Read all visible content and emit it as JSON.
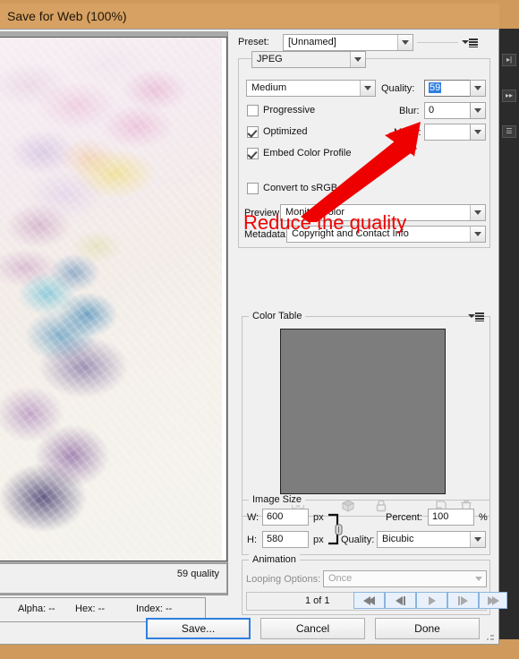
{
  "window": {
    "title": "Save for Web (100%)",
    "accent_tan": "#d6a163"
  },
  "annotation": {
    "text": "Reduce the quality",
    "color": "#ee0000",
    "arrow": "red-arrow-up-right"
  },
  "preview": {
    "status_label": "59 quality"
  },
  "color_info": {
    "alpha": "Alpha: --",
    "hex": "Hex: --",
    "index": "Index: --"
  },
  "settings": {
    "preset_label": "Preset:",
    "preset_value": "[Unnamed]",
    "format_value": "JPEG",
    "compression_value": "Medium",
    "quality_label": "Quality:",
    "quality_value": "59",
    "blur_label": "Blur:",
    "blur_value": "0",
    "matte_label": "Matte:",
    "matte_value": "",
    "checkboxes": [
      {
        "label": "Progressive",
        "checked": false
      },
      {
        "label": "Optimized",
        "checked": true
      },
      {
        "label": "Embed Color Profile",
        "checked": true
      },
      {
        "label": "Convert to sRGB",
        "checked": false
      }
    ],
    "preview_label": "Preview:",
    "preview_value": "Monitor Color",
    "metadata_label": "Metadata:",
    "metadata_value": "Copyright and Contact Info"
  },
  "color_table": {
    "title": "Color Table",
    "swatch_color": "#7d7d7d",
    "icons": [
      "transparency-icon",
      "web-shift-icon",
      "lock-icon",
      "new-color-icon",
      "trash-icon"
    ]
  },
  "image_size": {
    "title": "Image Size",
    "w_label": "W:",
    "w_value": "600",
    "w_unit": "px",
    "h_label": "H:",
    "h_value": "580",
    "h_unit": "px",
    "percent_label": "Percent:",
    "percent_value": "100",
    "percent_unit": "%",
    "quality_label": "Quality:",
    "quality_value": "Bicubic"
  },
  "animation": {
    "title": "Animation",
    "looping_label": "Looping Options:",
    "looping_value": "Once",
    "frame_counter": "1 of 1",
    "transport": [
      "first-frame-icon",
      "previous-frame-icon",
      "play-icon",
      "next-frame-icon",
      "last-frame-icon"
    ]
  },
  "footer": {
    "save_label": "Save...",
    "cancel_label": "Cancel",
    "done_label": "Done"
  }
}
